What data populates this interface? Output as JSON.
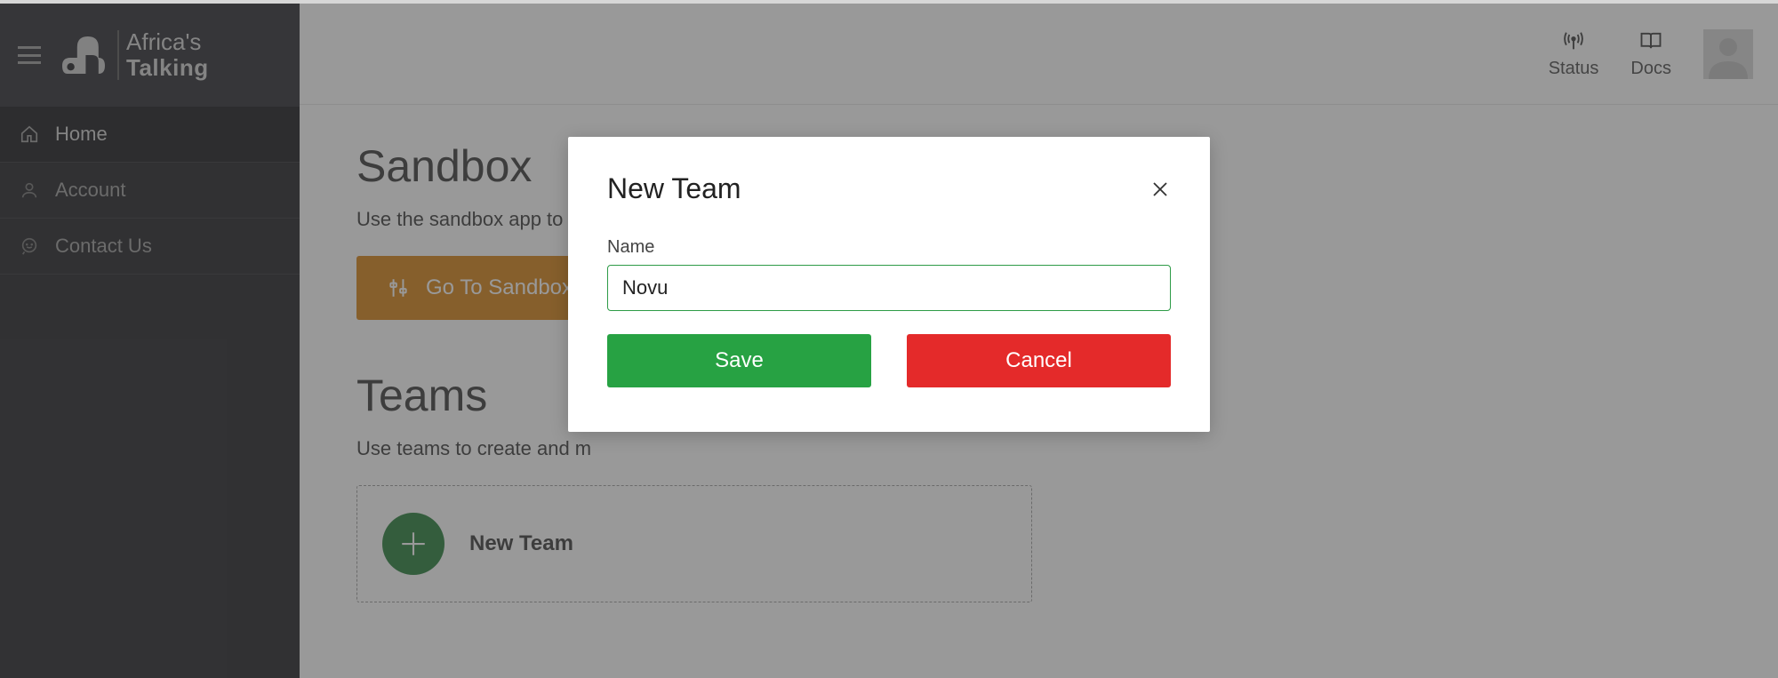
{
  "brand": {
    "line1": "Africa's",
    "line2": "Talking"
  },
  "sidebar": {
    "items": [
      {
        "label": "Home"
      },
      {
        "label": "Account"
      },
      {
        "label": "Contact Us"
      }
    ]
  },
  "topbar": {
    "status_label": "Status",
    "docs_label": "Docs"
  },
  "sandbox": {
    "title": "Sandbox",
    "subtitle": "Use the sandbox app to bu",
    "button_label": "Go To Sandbox App"
  },
  "teams": {
    "title": "Teams",
    "subtitle": "Use teams to create and m",
    "new_team_label": "New Team"
  },
  "modal": {
    "title": "New Team",
    "field_label": "Name",
    "name_value": "Novu",
    "save_label": "Save",
    "cancel_label": "Cancel"
  }
}
